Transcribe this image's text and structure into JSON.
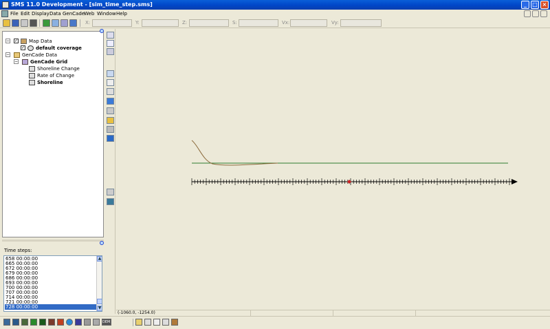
{
  "window": {
    "title": "SMS 11.0 Development - [sim_time_step.sms]",
    "buttons": [
      "_",
      "□",
      "×"
    ]
  },
  "menu": [
    "File",
    "Edit",
    "Display",
    "Data",
    "GenCade",
    "Web",
    "Window",
    "Help"
  ],
  "toolbar": {
    "icons": [
      "open-icon",
      "save-icon",
      "print-icon",
      "delete-icon",
      "refresh-icon",
      "frame-icon",
      "rotate-icon",
      "measure-icon"
    ],
    "coords": [
      {
        "label": "X:",
        "value": ""
      },
      {
        "label": "Y:",
        "value": ""
      },
      {
        "label": "Z:",
        "value": ""
      },
      {
        "label": "S:",
        "value": ""
      },
      {
        "label": "Vx:",
        "value": ""
      },
      {
        "label": "Vy:",
        "value": ""
      }
    ]
  },
  "tree": {
    "items": [
      {
        "label": "Map Data",
        "bold": false,
        "expander": "−",
        "checked": true
      },
      {
        "label": "default coverage",
        "bold": true,
        "checked": true
      },
      {
        "label": "GenCade Data",
        "bold": false,
        "expander": "−"
      },
      {
        "label": "GenCade Grid",
        "bold": true,
        "expander": "−"
      },
      {
        "label": "Shoreline Change",
        "bold": false
      },
      {
        "label": "Rate of Change",
        "bold": false
      },
      {
        "label": "Shoreline",
        "bold": true
      }
    ]
  },
  "timesteps": {
    "label": "Time steps:",
    "items": [
      "658 00:00:00",
      "665 00:00:00",
      "672 00:00:00",
      "679 00:00:00",
      "686 00:00:00",
      "693 00:00:00",
      "700 00:00:00",
      "707 00:00:00",
      "714 00:00:00",
      "721 00:00:00",
      "728 00:00:00"
    ],
    "selected_index": 10
  },
  "side_tools": [
    "select-icon",
    "zoom-icon",
    "pan-icon",
    "create-cell-icon",
    "node-icon",
    "transect-icon",
    "structure-icon",
    "breakwater-icon",
    "jetty-icon",
    "shore-icon",
    "grid-icon",
    "table-icon",
    "display-icon"
  ],
  "status": {
    "coords": "(-1060.0, -1254.0)"
  },
  "colors": {
    "titlebar": "#0a5fd8",
    "shoreline_initial": "#2e7d2e",
    "shoreline_current": "#8b6a3c",
    "grid_axis": "#000000",
    "marker": "#cc2222",
    "selection": "#316ac5"
  }
}
